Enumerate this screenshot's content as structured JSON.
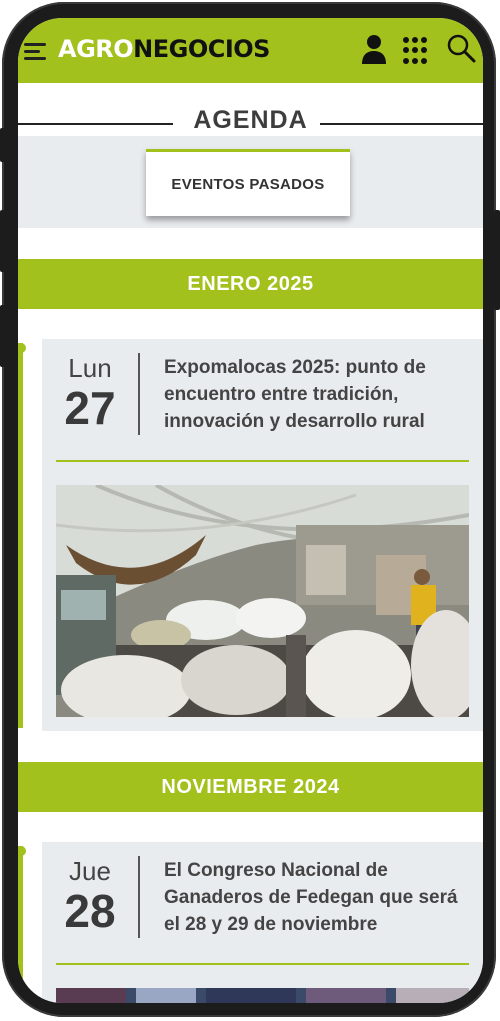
{
  "header": {
    "logo_part1": "AGRO",
    "logo_part2": "NEGOCIOS"
  },
  "page": {
    "section_title": "AGENDA",
    "past_events_label": "EVENTOS PASADOS"
  },
  "months": [
    {
      "label": "ENERO 2025",
      "events": [
        {
          "day_name": "Lun",
          "day_number": "27",
          "title": "Expomalocas 2025: punto de encuentro entre tradición, innovación y desarrollo rural",
          "image_desc": "cattle-exhibition-photo"
        }
      ]
    },
    {
      "label": "NOVIEMBRE 2024",
      "events": [
        {
          "day_name": "Jue",
          "day_number": "28",
          "title": "El Congreso Nacional de Ganaderos de Fedegan que será el 28 y 29 de noviembre",
          "image_desc": "congress-photo"
        }
      ]
    }
  ],
  "colors": {
    "accent": "#a2c11c",
    "card_bg": "#e9ecef",
    "text": "#444444"
  }
}
